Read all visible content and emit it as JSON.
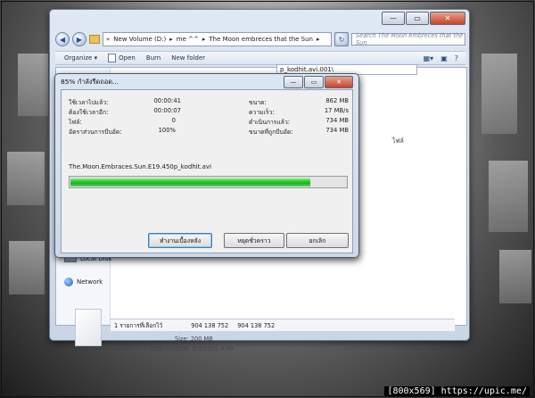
{
  "explorer": {
    "caption_buttons": {
      "minimize": "—",
      "maximize": "▭",
      "close": "✕"
    },
    "address": {
      "prefix": "«",
      "segments": [
        "New Volume (D:)",
        "me ^^",
        "The Moon embreces that the Sun"
      ],
      "separator": "▸"
    },
    "search_placeholder": "Search The Moon embreces that the Sun",
    "toolbar": {
      "organize": "Organize ▾",
      "open": "Open",
      "burn": "Burn",
      "new_folder": "New folder"
    },
    "inner_path": "p_kodhit.avi.001\\",
    "column_header": "ไฟล์",
    "nav": {
      "local_disk": "Local Disk",
      "network": "Network"
    },
    "status": {
      "selected": "1 รายการที่เลือกไว้",
      "size1": "904 138 752",
      "size2": "904 138 752"
    },
    "details": {
      "size": "Size: 200 MB",
      "date_created": "Date created: 9/5/2555 8:46"
    }
  },
  "dialog": {
    "title": "85% กำลังรีดถอด...",
    "caption_buttons": {
      "minimize": "—",
      "maximize": "▭",
      "close": "✕"
    },
    "left_stats": [
      {
        "label": "ใช้เวลาไปแล้ว:",
        "value": "00:00:41"
      },
      {
        "label": "ต้องใช้เวลาอีก:",
        "value": "00:00:07"
      },
      {
        "label": "ไฟล์:",
        "value": "0"
      },
      {
        "label": "อัตราส่วนการบีบอัด:",
        "value": "100%"
      }
    ],
    "right_stats": [
      {
        "label": "ขนาด:",
        "value": "862 MB"
      },
      {
        "label": "ความเร็ว:",
        "value": "17 MB/s"
      },
      {
        "label": "ดำเนินการแล้ว:",
        "value": "734 MB"
      },
      {
        "label": "ขนาดที่ถูกบีบอัด:",
        "value": "734 MB"
      }
    ],
    "filename": "The.Moon.Embraces.Sun.E19.450p_kodhit.avi",
    "progress": 0.87,
    "buttons": {
      "background": "ทำงานเบื้องหลัง",
      "pause": "หยุดชั่วคราว",
      "cancel": "ยกเลิก"
    }
  },
  "watermark": "[800x569] https://upic.me/"
}
